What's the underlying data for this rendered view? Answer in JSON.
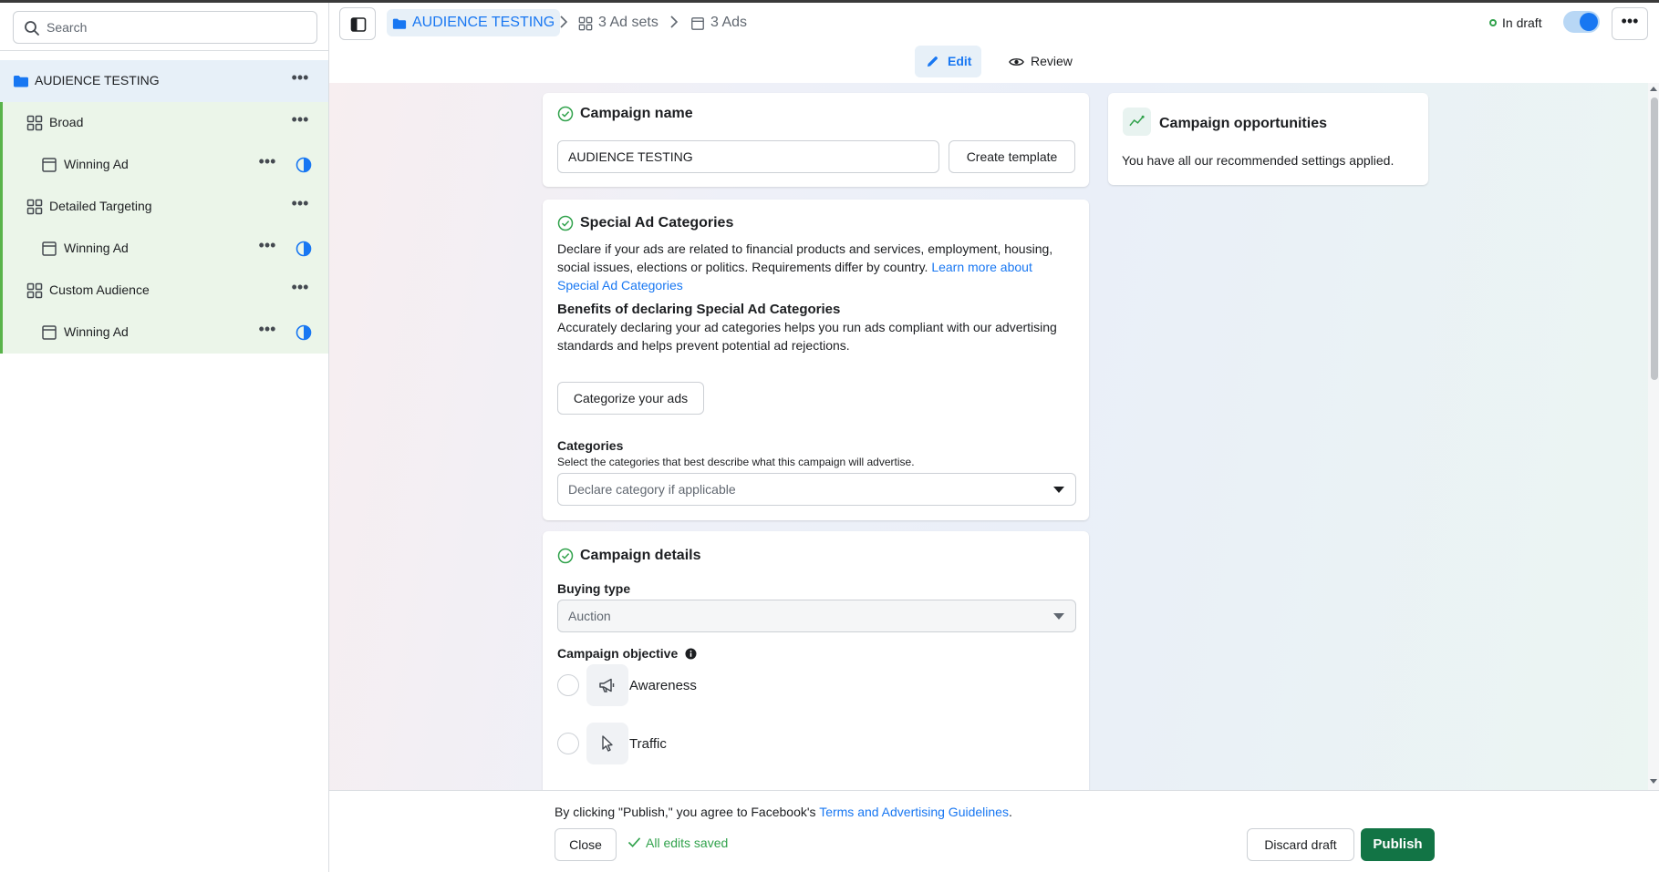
{
  "sidebar": {
    "search_placeholder": "Search",
    "campaign": {
      "label": "AUDIENCE TESTING"
    },
    "items": [
      {
        "label": "Broad",
        "type": "adset"
      },
      {
        "label": "Winning Ad",
        "type": "ad"
      },
      {
        "label": "Detailed Targeting",
        "type": "adset"
      },
      {
        "label": "Winning Ad",
        "type": "ad"
      },
      {
        "label": "Custom Audience",
        "type": "adset"
      },
      {
        "label": "Winning Ad",
        "type": "ad"
      }
    ]
  },
  "header": {
    "breadcrumb": {
      "campaign": "AUDIENCE TESTING",
      "adsets": "3 Ad sets",
      "ads": "3 Ads"
    },
    "status": "In draft",
    "toggle_on": true
  },
  "mode_tabs": {
    "edit": "Edit",
    "review": "Review",
    "active": "Edit"
  },
  "campaign_name_card": {
    "title": "Campaign name",
    "value": "AUDIENCE TESTING",
    "create_template_label": "Create template"
  },
  "opportunities_card": {
    "title": "Campaign opportunities",
    "text": "You have all our recommended settings applied."
  },
  "special_ad_card": {
    "title": "Special Ad Categories",
    "description": "Declare if your ads are related to financial products and services, employment, housing, social issues, elections or politics. Requirements differ by country.",
    "learn_more_link": "Learn more about Special Ad Categories",
    "benefits_heading": "Benefits of declaring Special Ad Categories",
    "benefits_text": "Accurately declaring your ad categories helps you run ads compliant with our advertising standards and helps prevent potential ad rejections.",
    "categorize_button": "Categorize your ads",
    "categories_label": "Categories",
    "categories_help": "Select the categories that best describe what this campaign will advertise.",
    "categories_placeholder": "Declare category if applicable"
  },
  "campaign_details_card": {
    "title": "Campaign details",
    "buying_type_label": "Buying type",
    "buying_type_value": "Auction",
    "objective_label": "Campaign objective",
    "objectives": [
      {
        "label": "Awareness",
        "icon": "megaphone-icon"
      },
      {
        "label": "Traffic",
        "icon": "cursor-icon"
      }
    ]
  },
  "footer": {
    "note_prefix": "By clicking \"Publish,\" you agree to Facebook's",
    "note_link": "Terms and Advertising Guidelines",
    "note_suffix": ".",
    "close_label": "Close",
    "saved_label": "All edits saved",
    "discard_label": "Discard draft",
    "publish_label": "Publish"
  },
  "colors": {
    "accent_blue": "#1877f2",
    "publish_green": "#127445",
    "saved_green": "#31a24c",
    "tree_green_bg": "#ebf5e9",
    "tree_selected_bg": "#e7f0f8"
  }
}
